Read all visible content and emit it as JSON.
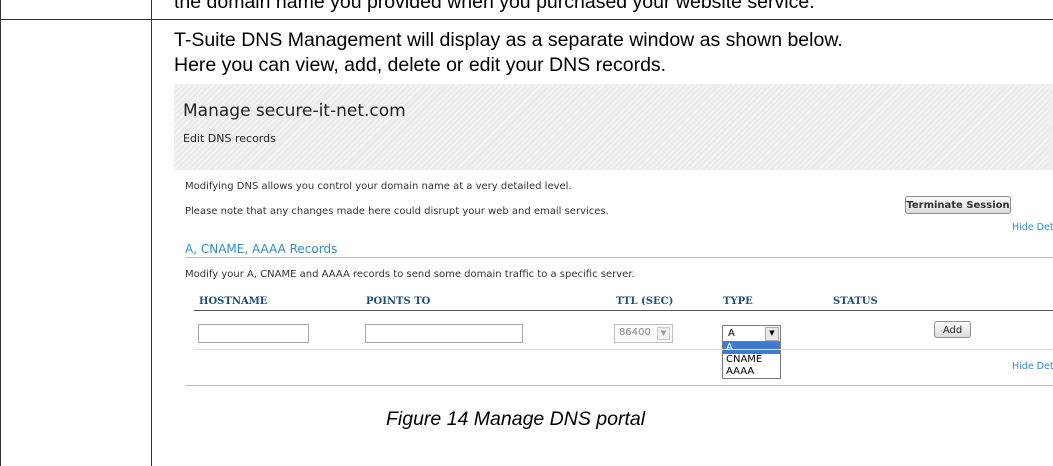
{
  "document": {
    "cut_line": "the domain name you provided when you purchased your website service.",
    "intro_line1": "T-Suite DNS Management will display as a separate window as shown below.",
    "intro_line2": "Here you can view, add, delete or edit your DNS records.",
    "caption": "Figure 14 Manage DNS portal"
  },
  "screenshot": {
    "title": "Manage secure-it-net.com",
    "subtitle": "Edit DNS records",
    "description_line1": "Modifying DNS allows you control your domain name at a very detailed level.",
    "description_line2": "Please note that any changes made here could disrupt your web and email services.",
    "terminate_button": "Terminate Session",
    "hide_details_top": "Hide Detail",
    "section_title": "A, CNAME, AAAA Records",
    "section_description": "Modify your A, CNAME and AAAA records to send some domain traffic to a specific server.",
    "columns": {
      "hostname": "HOSTNAME",
      "points_to": "POINTS TO",
      "ttl": "TTL (SEC)",
      "type": "TYPE",
      "status": "STATUS"
    },
    "row": {
      "hostname_value": "",
      "points_to_value": "",
      "ttl_value": "86400",
      "type_value": "A"
    },
    "type_options": [
      "A",
      "CNAME",
      "AAAA"
    ],
    "type_selected": "A",
    "add_button": "Add",
    "hide_details_bottom": "Hide Detail",
    "colors": {
      "link": "#2a8fd0",
      "section_title": "#2b8fc8",
      "column_header": "#1f4e79",
      "dropdown_selected": "#3a7bd5"
    },
    "icons": {
      "ttl_select": "chevron-down-icon",
      "type_select": "chevron-down-icon"
    }
  }
}
